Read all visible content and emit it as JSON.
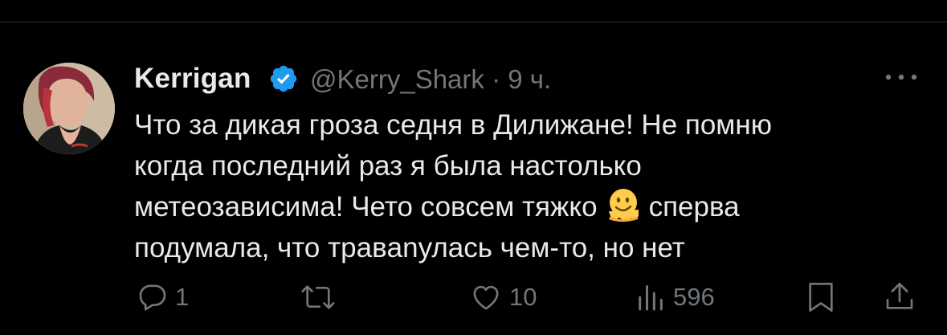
{
  "tweet": {
    "author_name": "Kerrigan",
    "handle_line": "@Kerry_Shark · 9 ч.",
    "text_lines": [
      "Что за дикая гроза седня в Дилижане! Не помню",
      "когда последний раз я была настолько",
      "метеозависима! Чето совсем тяжко",
      "сперва",
      "подумала, что травanулась чем-то, но нет"
    ]
  },
  "actions": {
    "reply_count": "1",
    "like_count": "10",
    "views_count": "596"
  },
  "colors": {
    "background": "#000000",
    "text": "#e7e9ea",
    "muted": "#71767b",
    "verified": "#1d9bf0",
    "emoji": "#ffcc4d"
  },
  "icons": [
    "verified-badge-icon",
    "more-icon",
    "melting-face-emoji",
    "reply-icon",
    "retweet-icon",
    "like-icon",
    "views-icon",
    "bookmark-icon",
    "share-icon"
  ]
}
